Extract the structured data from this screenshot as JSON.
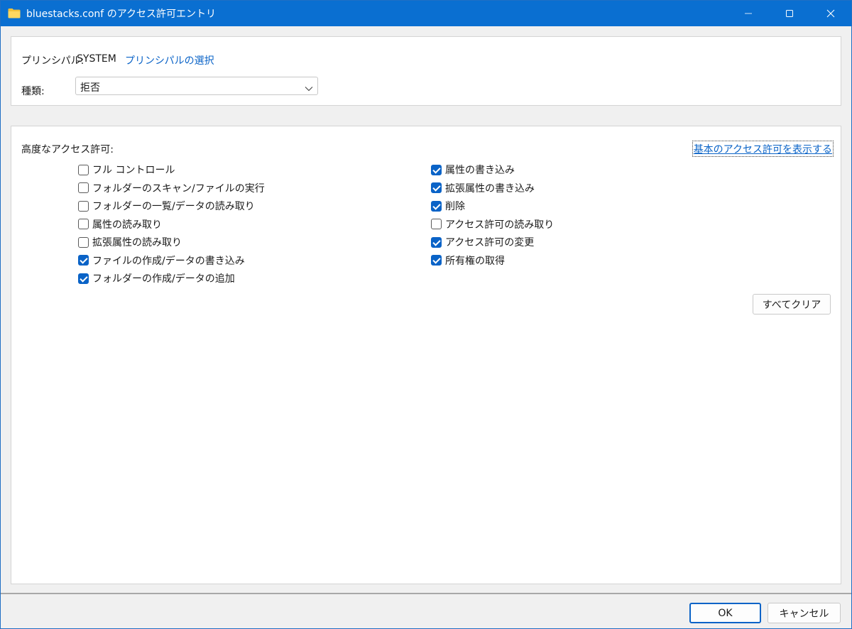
{
  "window": {
    "title": "bluestacks.conf のアクセス許可エントリ",
    "icon": "folder-icon"
  },
  "principal": {
    "label": "プリンシパル:",
    "value": "SYSTEM",
    "select_link": "プリンシパルの選択"
  },
  "type": {
    "label": "種類:",
    "selected": "拒否"
  },
  "advanced": {
    "label": "高度なアクセス許可:",
    "basic_link": "基本のアクセス許可を表示する",
    "left": [
      {
        "label": "フル コントロール",
        "checked": false
      },
      {
        "label": "フォルダーのスキャン/ファイルの実行",
        "checked": false
      },
      {
        "label": "フォルダーの一覧/データの読み取り",
        "checked": false
      },
      {
        "label": "属性の読み取り",
        "checked": false
      },
      {
        "label": "拡張属性の読み取り",
        "checked": false
      },
      {
        "label": "ファイルの作成/データの書き込み",
        "checked": true
      },
      {
        "label": "フォルダーの作成/データの追加",
        "checked": true
      }
    ],
    "right": [
      {
        "label": "属性の書き込み",
        "checked": true
      },
      {
        "label": "拡張属性の書き込み",
        "checked": true
      },
      {
        "label": "削除",
        "checked": true
      },
      {
        "label": "アクセス許可の読み取り",
        "checked": false
      },
      {
        "label": "アクセス許可の変更",
        "checked": true
      },
      {
        "label": "所有権の取得",
        "checked": true
      }
    ],
    "clear_all": "すべてクリア"
  },
  "footer": {
    "ok": "OK",
    "cancel": "キャンセル"
  },
  "colors": {
    "titlebar": "#0a6fd1",
    "accent": "#0a63c7",
    "background": "#f0f0f0"
  }
}
